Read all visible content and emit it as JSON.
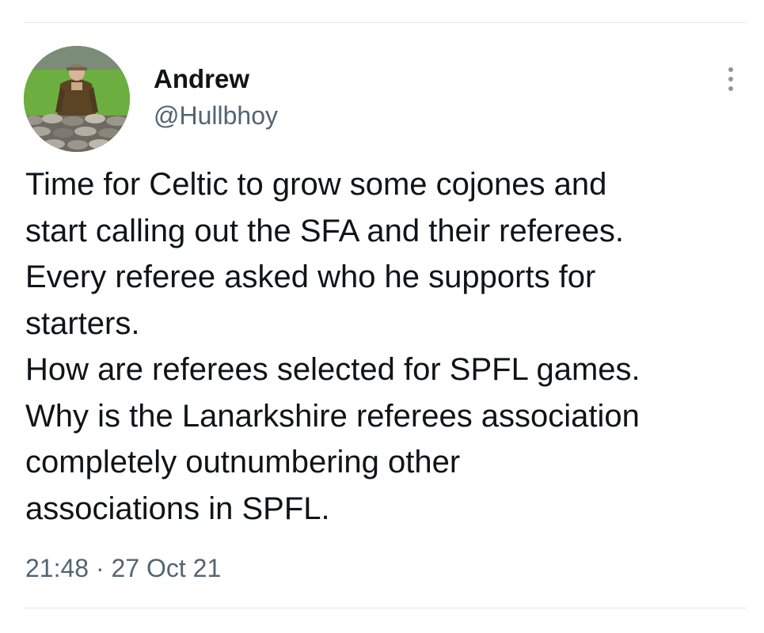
{
  "user": {
    "display_name": "Andrew",
    "handle": "@Hullbhoy",
    "avatar_icon": "profile-photo"
  },
  "menu": {
    "icon": "more-vertical-icon"
  },
  "tweet": {
    "lines": [
      "Time for Celtic to grow some cojones and",
      "start calling out the SFA and their referees.",
      "Every referee asked who he supports for",
      "starters.",
      "How are referees selected for SPFL games.",
      "Why is the Lanarkshire referees association",
      "completely outnumbering other",
      "associations in SPFL."
    ],
    "time": "21:48",
    "separator": "·",
    "date": "27 Oct 21"
  },
  "colors": {
    "text": "#0f1419",
    "secondary": "#536471",
    "divider": "#e6e8ea"
  }
}
